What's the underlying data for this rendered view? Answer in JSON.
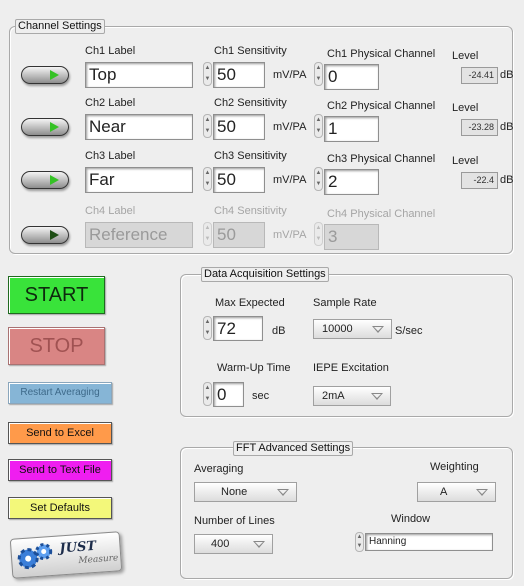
{
  "channel_settings": {
    "title": "Channel Settings",
    "channels": [
      {
        "label_title": "Ch1 Label",
        "label": "Top",
        "sens_title": "Ch1 Sensitivity",
        "sens": "50",
        "unit": "mV/PA",
        "phys_title": "Ch1 Physical Channel",
        "phys": "0",
        "level_title": "Level",
        "level": "-24.41",
        "db": "dB",
        "enabled": true
      },
      {
        "label_title": "Ch2 Label",
        "label": "Near",
        "sens_title": "Ch2 Sensitivity",
        "sens": "50",
        "unit": "mV/PA",
        "phys_title": "Ch2 Physical Channel",
        "phys": "1",
        "level_title": "Level",
        "level": "-23.28",
        "db": "dB",
        "enabled": true
      },
      {
        "label_title": "Ch3 Label",
        "label": "Far",
        "sens_title": "Ch3 Sensitivity",
        "sens": "50",
        "unit": "mV/PA",
        "phys_title": "Ch3 Physical Channel",
        "phys": "2",
        "level_title": "Level",
        "level": "-22.4",
        "db": "dB",
        "enabled": true
      },
      {
        "label_title": "Ch4 Label",
        "label": "Reference",
        "sens_title": "Ch4 Sensitivity",
        "sens": "50",
        "unit": "mV/PA",
        "phys_title": "Ch4 Physical Channel",
        "phys": "3",
        "enabled": false
      }
    ]
  },
  "buttons": {
    "start": "START",
    "stop": "STOP",
    "restart": "Restart Averaging",
    "excel": "Send to Excel",
    "text_file": "Send to Text File",
    "defaults": "Set Defaults"
  },
  "daq": {
    "title": "Data Acquisition Settings",
    "max_expected_label": "Max Expected",
    "max_expected": "72",
    "max_expected_unit": "dB",
    "sample_rate_label": "Sample Rate",
    "sample_rate": "10000",
    "sample_rate_unit": "S/sec",
    "warmup_label": "Warm-Up Time",
    "warmup": "0",
    "warmup_unit": "sec",
    "iepe_label": "IEPE Excitation",
    "iepe": "2mA"
  },
  "fft": {
    "title": "FFT Advanced Settings",
    "averaging_label": "Averaging",
    "averaging": "None",
    "weighting_label": "Weighting",
    "weighting": "A",
    "lines_label": "Number of Lines",
    "lines": "400",
    "window_label": "Window",
    "window": "Hanning"
  },
  "logo": {
    "text_main": "JUST",
    "text_sub": "Measure"
  },
  "colors": {
    "start": "#39e33a",
    "stop": "#d98584",
    "restart": "#86b5d6",
    "excel": "#ff9a4a",
    "text_file": "#ef1ef0",
    "defaults": "#f3f87a"
  }
}
